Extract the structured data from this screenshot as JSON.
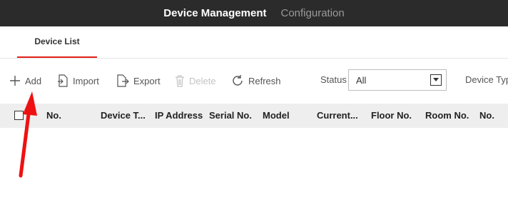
{
  "header": {
    "title": "Device Management",
    "nav_item": "Configuration"
  },
  "tabs": [
    {
      "label": "Device List",
      "active": true
    }
  ],
  "toolbar": {
    "add": "Add",
    "import": "Import",
    "export": "Export",
    "delete": "Delete",
    "refresh": "Refresh"
  },
  "filters": {
    "status_label": "Status",
    "status_value": "All",
    "device_type_label": "Device Typ"
  },
  "table": {
    "columns": [
      "No.",
      "Device T...",
      "IP Address",
      "Serial No.",
      "Model",
      "Current...",
      "Floor No.",
      "Room No.",
      "No."
    ]
  },
  "colors": {
    "topbar": "#2b2b2b",
    "accent": "#e2231a",
    "table_header": "#eeeeee"
  }
}
